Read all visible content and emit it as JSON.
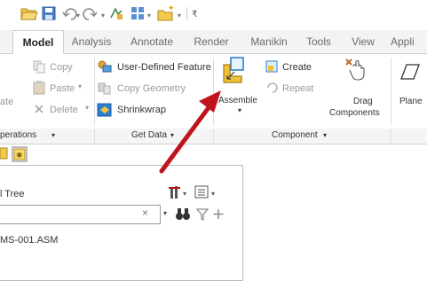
{
  "tabs": [
    {
      "label": "Model",
      "active": true
    },
    {
      "label": "Analysis"
    },
    {
      "label": "Annotate"
    },
    {
      "label": "Render"
    },
    {
      "label": "Manikin"
    },
    {
      "label": "Tools"
    },
    {
      "label": "View"
    },
    {
      "label": "Appli"
    }
  ],
  "ribbon": {
    "clipboard": {
      "copy": "Copy",
      "paste": "Paste",
      "delete": "Delete",
      "partial_left": "ate"
    },
    "get_data": {
      "user_defined_feature": "User-Defined Feature",
      "copy_geometry": "Copy Geometry",
      "shrinkwrap": "Shrinkwrap"
    },
    "component": {
      "assemble": "Assemble",
      "create": "Create",
      "repeat": "Repeat",
      "drag_line1": "Drag",
      "drag_line2": "Components"
    },
    "datum": {
      "plane": "Plane"
    }
  },
  "groups": {
    "operations": "perations",
    "get_data": "Get Data",
    "component": "Component"
  },
  "model_tree": {
    "title": "l Tree",
    "root_item": "MS-001.ASM"
  },
  "colors": {
    "annotation_arrow": "#c0141c",
    "assemble_icon": "#f0c23a",
    "accent_blue": "#2d7fd0"
  }
}
